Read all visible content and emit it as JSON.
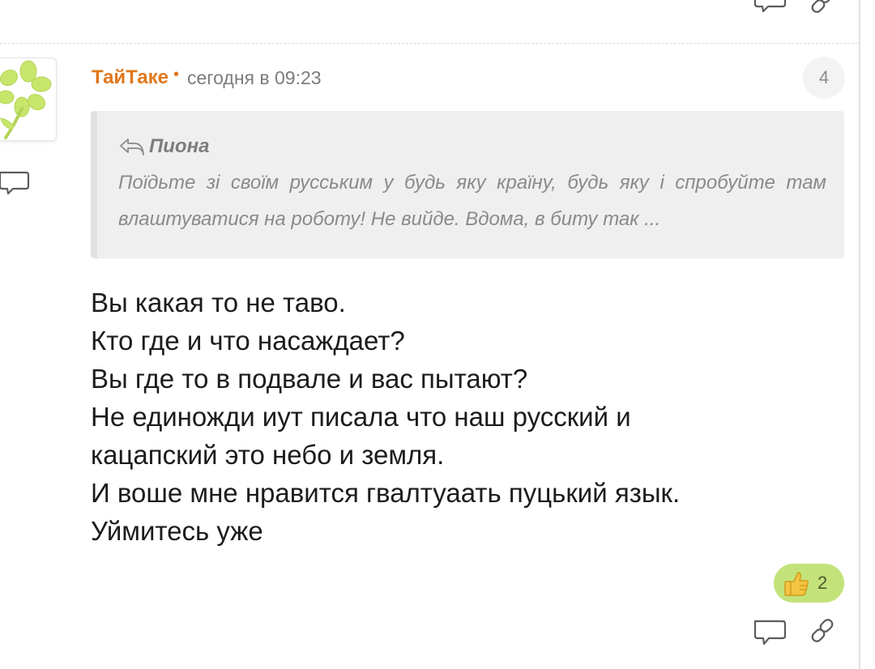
{
  "comment": {
    "author": "ТайТаке",
    "timestamp": "сегодня в 09:23",
    "rank": "4",
    "quote": {
      "author": "Пиона",
      "text": "Поїдьте зі своїм русським у будь яку країну, будь яку і спробуйте там влаштуватися на роботу! Не вийде. Вдома, в биту так ..."
    },
    "body_lines": [
      "Вы какая то не таво.",
      "Кто где и что насаждает?",
      "Вы где то в подвале и вас пытают?",
      "Не единожди иут писала что наш русский и",
      "кацапский это небо и земля.",
      "И воше мне нравится гвалтуаать пуцький язык.",
      "Уймитесь уже"
    ],
    "likes": "2"
  },
  "icons": {
    "reply": "speech-bubble-icon",
    "link": "link-icon",
    "like": "thumbs-up-icon",
    "quote_reply": "reply-arrow-icon",
    "avatar": "flower-avatar"
  },
  "colors": {
    "author": "#e0781c",
    "like_pill": "#c3e37a",
    "quote_bg": "#efefef"
  }
}
